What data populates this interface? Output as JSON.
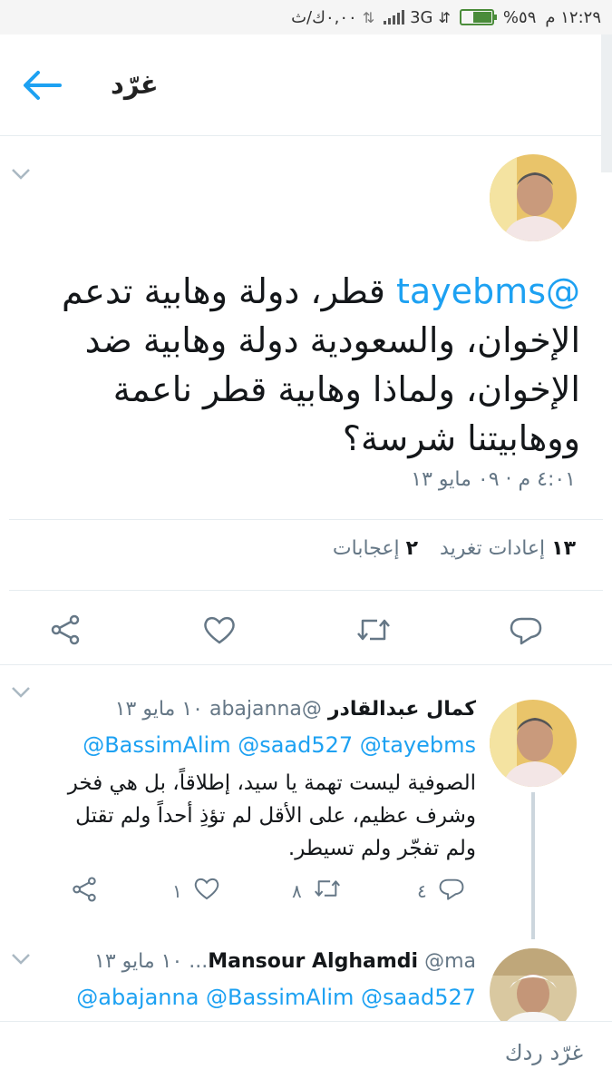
{
  "status_bar": {
    "time": "١٢:٢٩ م",
    "battery_percent_label": "%٥٩",
    "battery_level": 0.59,
    "network": "3G",
    "data_speed": "٠,٠٠ك/ث"
  },
  "app_bar": {
    "title": "غرّد"
  },
  "tweet": {
    "mention": "@tayebms",
    "text": "قطر، دولة وهابية تدعم الإخوان، والسعودية دولة وهابية ضد الإخوان، ولماذا وهابية قطر ناعمة ووهابيتنا شرسة؟",
    "timestamp": "٤:٠١ م · ٠٩ مايو ١٣",
    "retweets_count": "١٣",
    "retweets_label": "إعادات تغريد",
    "likes_count": "٢",
    "likes_label": "إعجابات"
  },
  "reply1": {
    "name": "كمال عبدالقادر",
    "handle": "@abajanna",
    "date": "١٠ مايو ١٣",
    "mentions": "@BassimAlim @saad527 @tayebms",
    "text": "الصوفية ليست تهمة يا سيد، إطلاقاً، بل هي فخر وشرف عظيم، على الأقل لم تؤذِ أحداً ولم تقتل ولم تفجّر ولم تسيطر.",
    "replies_count": "٤",
    "retweets_count": "٨",
    "likes_count": "١"
  },
  "reply2": {
    "name": "Mansour Alghamdi",
    "handle": "@ma...",
    "date": "١٠ مايو ١٣",
    "mentions": "@abajanna @BassimAlim @saad527"
  },
  "composer": {
    "placeholder": "غرّد ردك"
  },
  "colors": {
    "accent": "#1da1f2",
    "muted": "#657786"
  }
}
